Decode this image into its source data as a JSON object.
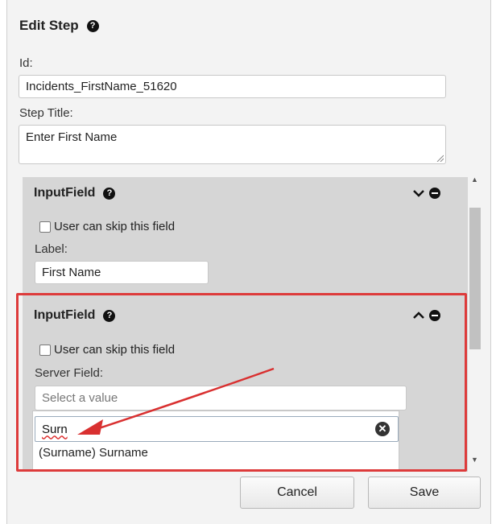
{
  "dialog": {
    "title": "Edit Step",
    "id_label": "Id:",
    "id_value": "Incidents_FirstName_51620",
    "step_title_label": "Step Title:",
    "step_title_value": "Enter First Name"
  },
  "fields": [
    {
      "type": "InputField",
      "skip_label": "User can skip this field",
      "label_label": "Label:",
      "label_value": "First Name",
      "expanded": false
    },
    {
      "type": "InputField",
      "skip_label": "User can skip this field",
      "server_field_label": "Server Field:",
      "select_placeholder": "Select a value",
      "search_value": "Surn",
      "options": [
        "(Surname) Surname"
      ],
      "expanded": true
    }
  ],
  "buttons": {
    "cancel": "Cancel",
    "save": "Save"
  },
  "colors": {
    "highlight": "#dd3b3b",
    "section_bg": "#d6d6d6",
    "panel_bg": "#f3f3f3"
  },
  "icons": [
    "help-icon",
    "chevron-down-icon",
    "chevron-up-icon",
    "remove-icon",
    "clear-icon",
    "resize-handle-icon"
  ]
}
